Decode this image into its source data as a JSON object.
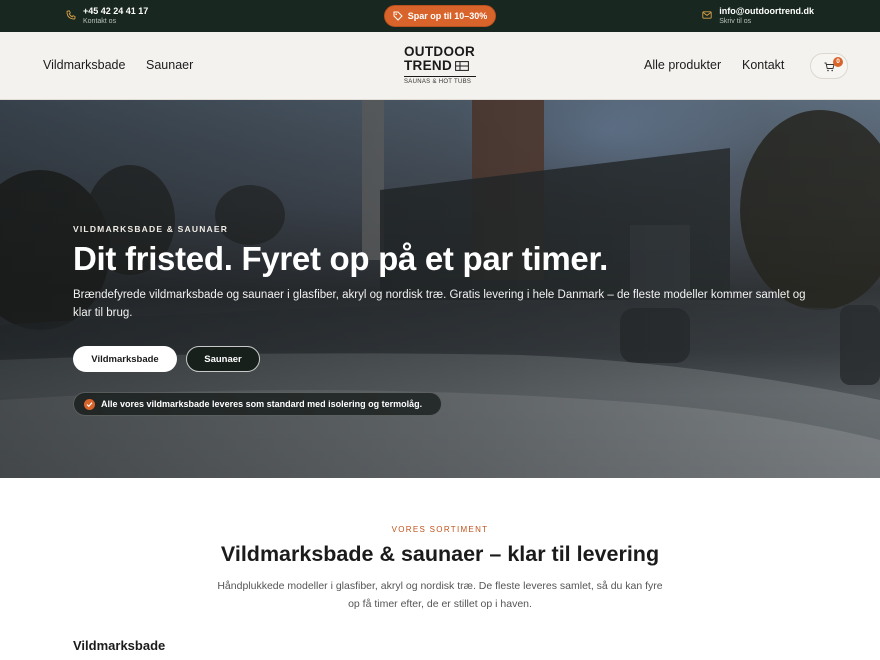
{
  "topbar": {
    "phone": "+45 42 24 41 17",
    "phone_sub": "Kontakt os",
    "promo": "Spar op til 10–30%",
    "email": "info@outdoortrend.dk",
    "email_sub": "Skriv til os",
    "icons": [
      "phone-icon",
      "tag-icon",
      "mail-icon"
    ]
  },
  "nav": {
    "left_links": [
      "Vildmarksbade",
      "Saunaer"
    ],
    "logo_line1": "OUTDOOR",
    "logo_line2": "TREND",
    "logo_sub": "SAUNAS & HOT TUBS",
    "right_links": [
      "Alle produkter",
      "Kontakt"
    ],
    "cart_count": "0"
  },
  "hero": {
    "eyebrow": "VILDMARKSBADE & SAUNAER",
    "title": "Dit fristed. Fyret op på et par timer.",
    "description": "Brændefyrede vildmarksbade og saunaer i glasfiber, akryl og nordisk træ. Gratis levering i hele Danmark – de fleste modeller kommer samlet og klar til brug.",
    "btn_primary": "Vildmarksbade",
    "btn_secondary": "Saunaer",
    "notice": "Alle vores vildmarksbade leveres som standard med isolering og termolåg."
  },
  "section": {
    "eyebrow": "VORES SORTIMENT",
    "title": "Vildmarksbade & saunaer – klar til levering",
    "description": "Håndplukkede modeller i glasfiber, akryl og nordisk træ. De fleste leveres samlet, så du kan fyre op få timer efter, de er stillet op i haven.",
    "category_title": "Vildmarksbade"
  },
  "colors": {
    "topbar_bg": "#18271f",
    "accent": "#d9642b",
    "nav_bg": "#f4f2ee"
  }
}
